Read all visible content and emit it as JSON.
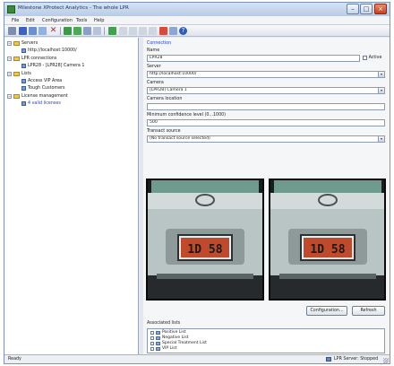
{
  "window": {
    "title": "Milestone XProtect Analytics - The whole LPR"
  },
  "menu": [
    "File",
    "Edit",
    "Configuration",
    "Tools",
    "Help"
  ],
  "tree": {
    "servers_label": "Servers",
    "server_item": "http://localhost:10000/",
    "lpr_label": "LPR connections",
    "lpr_item": "LPR28 - [LPR28] Camera 1",
    "lists_label": "Lists",
    "list_items": [
      "Access VIP Area",
      "Tough Customers"
    ],
    "license_label": "License management",
    "license_item": "4 valid licenses"
  },
  "panel": {
    "connection_header": "Connection",
    "name_label": "Name",
    "name_value": "LPR28",
    "active_label": "Active",
    "server_label": "Server",
    "server_value": "http://localhost:10000/",
    "camera_label": "Camera",
    "camera_value": "[LPR28] Camera 1",
    "camera_location_label": "Camera location",
    "camera_location_value": "",
    "min_conf_label": "Minimum confidence level (0...1000)",
    "min_conf_value": "500",
    "transact_label": "Transact source",
    "transact_value": "(No transact source selected)",
    "configuration_btn": "Configuration...",
    "refresh_btn": "Refresh",
    "associated_lists_label": "Associated lists",
    "associated_lists": [
      "Positive List",
      "Negative List",
      "Special Treatment List",
      "VIP List"
    ]
  },
  "plate": {
    "left_text": "1D 58",
    "right_text": "1D 58"
  },
  "status": {
    "left": "Ready",
    "right": "LPR Server: Stopped"
  },
  "colors": {
    "accent": "#1f3fd6",
    "titlebar": "#b8cbe8"
  }
}
